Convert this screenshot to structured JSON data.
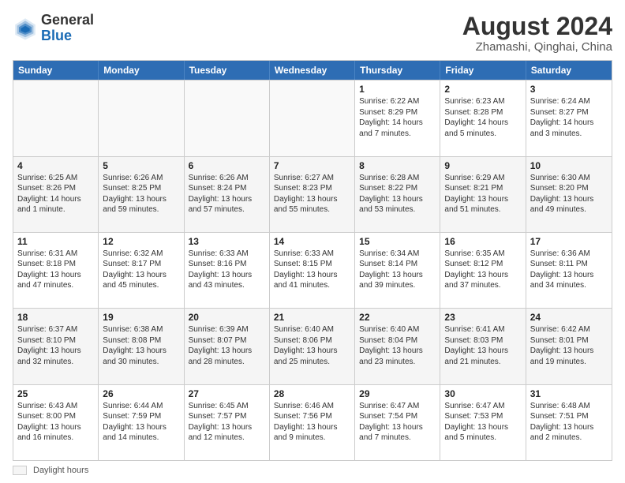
{
  "header": {
    "logo_general": "General",
    "logo_blue": "Blue",
    "main_title": "August 2024",
    "subtitle": "Zhamashi, Qinghai, China"
  },
  "calendar": {
    "days_of_week": [
      "Sunday",
      "Monday",
      "Tuesday",
      "Wednesday",
      "Thursday",
      "Friday",
      "Saturday"
    ],
    "rows": [
      [
        {
          "day": "",
          "text": "",
          "empty": true
        },
        {
          "day": "",
          "text": "",
          "empty": true
        },
        {
          "day": "",
          "text": "",
          "empty": true
        },
        {
          "day": "",
          "text": "",
          "empty": true
        },
        {
          "day": "1",
          "text": "Sunrise: 6:22 AM\nSunset: 8:29 PM\nDaylight: 14 hours and 7 minutes."
        },
        {
          "day": "2",
          "text": "Sunrise: 6:23 AM\nSunset: 8:28 PM\nDaylight: 14 hours and 5 minutes."
        },
        {
          "day": "3",
          "text": "Sunrise: 6:24 AM\nSunset: 8:27 PM\nDaylight: 14 hours and 3 minutes."
        }
      ],
      [
        {
          "day": "4",
          "text": "Sunrise: 6:25 AM\nSunset: 8:26 PM\nDaylight: 14 hours and 1 minute."
        },
        {
          "day": "5",
          "text": "Sunrise: 6:26 AM\nSunset: 8:25 PM\nDaylight: 13 hours and 59 minutes."
        },
        {
          "day": "6",
          "text": "Sunrise: 6:26 AM\nSunset: 8:24 PM\nDaylight: 13 hours and 57 minutes."
        },
        {
          "day": "7",
          "text": "Sunrise: 6:27 AM\nSunset: 8:23 PM\nDaylight: 13 hours and 55 minutes."
        },
        {
          "day": "8",
          "text": "Sunrise: 6:28 AM\nSunset: 8:22 PM\nDaylight: 13 hours and 53 minutes."
        },
        {
          "day": "9",
          "text": "Sunrise: 6:29 AM\nSunset: 8:21 PM\nDaylight: 13 hours and 51 minutes."
        },
        {
          "day": "10",
          "text": "Sunrise: 6:30 AM\nSunset: 8:20 PM\nDaylight: 13 hours and 49 minutes."
        }
      ],
      [
        {
          "day": "11",
          "text": "Sunrise: 6:31 AM\nSunset: 8:18 PM\nDaylight: 13 hours and 47 minutes."
        },
        {
          "day": "12",
          "text": "Sunrise: 6:32 AM\nSunset: 8:17 PM\nDaylight: 13 hours and 45 minutes."
        },
        {
          "day": "13",
          "text": "Sunrise: 6:33 AM\nSunset: 8:16 PM\nDaylight: 13 hours and 43 minutes."
        },
        {
          "day": "14",
          "text": "Sunrise: 6:33 AM\nSunset: 8:15 PM\nDaylight: 13 hours and 41 minutes."
        },
        {
          "day": "15",
          "text": "Sunrise: 6:34 AM\nSunset: 8:14 PM\nDaylight: 13 hours and 39 minutes."
        },
        {
          "day": "16",
          "text": "Sunrise: 6:35 AM\nSunset: 8:12 PM\nDaylight: 13 hours and 37 minutes."
        },
        {
          "day": "17",
          "text": "Sunrise: 6:36 AM\nSunset: 8:11 PM\nDaylight: 13 hours and 34 minutes."
        }
      ],
      [
        {
          "day": "18",
          "text": "Sunrise: 6:37 AM\nSunset: 8:10 PM\nDaylight: 13 hours and 32 minutes."
        },
        {
          "day": "19",
          "text": "Sunrise: 6:38 AM\nSunset: 8:08 PM\nDaylight: 13 hours and 30 minutes."
        },
        {
          "day": "20",
          "text": "Sunrise: 6:39 AM\nSunset: 8:07 PM\nDaylight: 13 hours and 28 minutes."
        },
        {
          "day": "21",
          "text": "Sunrise: 6:40 AM\nSunset: 8:06 PM\nDaylight: 13 hours and 25 minutes."
        },
        {
          "day": "22",
          "text": "Sunrise: 6:40 AM\nSunset: 8:04 PM\nDaylight: 13 hours and 23 minutes."
        },
        {
          "day": "23",
          "text": "Sunrise: 6:41 AM\nSunset: 8:03 PM\nDaylight: 13 hours and 21 minutes."
        },
        {
          "day": "24",
          "text": "Sunrise: 6:42 AM\nSunset: 8:01 PM\nDaylight: 13 hours and 19 minutes."
        }
      ],
      [
        {
          "day": "25",
          "text": "Sunrise: 6:43 AM\nSunset: 8:00 PM\nDaylight: 13 hours and 16 minutes."
        },
        {
          "day": "26",
          "text": "Sunrise: 6:44 AM\nSunset: 7:59 PM\nDaylight: 13 hours and 14 minutes."
        },
        {
          "day": "27",
          "text": "Sunrise: 6:45 AM\nSunset: 7:57 PM\nDaylight: 13 hours and 12 minutes."
        },
        {
          "day": "28",
          "text": "Sunrise: 6:46 AM\nSunset: 7:56 PM\nDaylight: 13 hours and 9 minutes."
        },
        {
          "day": "29",
          "text": "Sunrise: 6:47 AM\nSunset: 7:54 PM\nDaylight: 13 hours and 7 minutes."
        },
        {
          "day": "30",
          "text": "Sunrise: 6:47 AM\nSunset: 7:53 PM\nDaylight: 13 hours and 5 minutes."
        },
        {
          "day": "31",
          "text": "Sunrise: 6:48 AM\nSunset: 7:51 PM\nDaylight: 13 hours and 2 minutes."
        }
      ]
    ]
  },
  "footer": {
    "legend_label": "Daylight hours"
  }
}
